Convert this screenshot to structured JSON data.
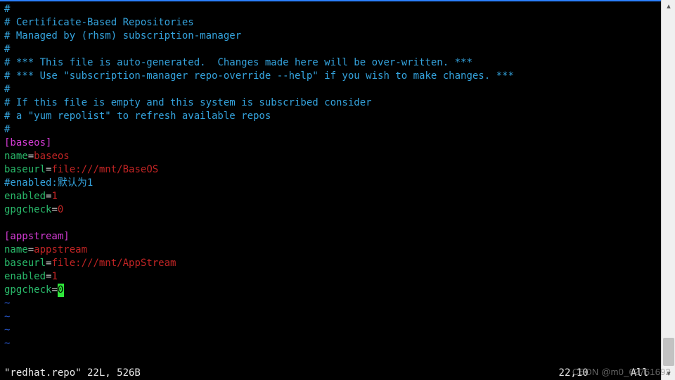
{
  "comments": {
    "l1": "#",
    "l2": "# Certificate-Based Repositories",
    "l3": "# Managed by (rhsm) subscription-manager",
    "l4": "#",
    "l5": "# *** This file is auto-generated.  Changes made here will be over-written. ***",
    "l6": "# *** Use \"subscription-manager repo-override --help\" if you wish to make changes. ***",
    "l7": "#",
    "l8": "# If this file is empty and this system is subscribed consider",
    "l9": "# a \"yum repolist\" to refresh available repos",
    "l10": "#"
  },
  "repo1": {
    "section": "[baseos]",
    "name_key": "name",
    "name_val": "baseos",
    "baseurl_key": "baseurl",
    "baseurl_val": "file:///mnt/BaseOS",
    "enabled_comment": "#enabled:默认为1",
    "enabled_key": "enabled",
    "enabled_val": "1",
    "gpg_key": "gpgcheck",
    "gpg_val": "0"
  },
  "repo2": {
    "section": "[appstream]",
    "name_key": "name",
    "name_val": "appstream",
    "baseurl_key": "baseurl",
    "baseurl_val": "file:///mnt/AppStream",
    "enabled_key": "enabled",
    "enabled_val": "1",
    "gpg_key": "gpgcheck",
    "gpg_val_cursor": "0"
  },
  "tilde": "~",
  "eq": "=",
  "status": {
    "filename": "\"redhat.repo\" 22L, 526B",
    "pos": "22,10",
    "all": "All"
  },
  "scroll": {
    "up": "▴",
    "down": "▾"
  },
  "watermark": "CSDN @m0_62761692"
}
